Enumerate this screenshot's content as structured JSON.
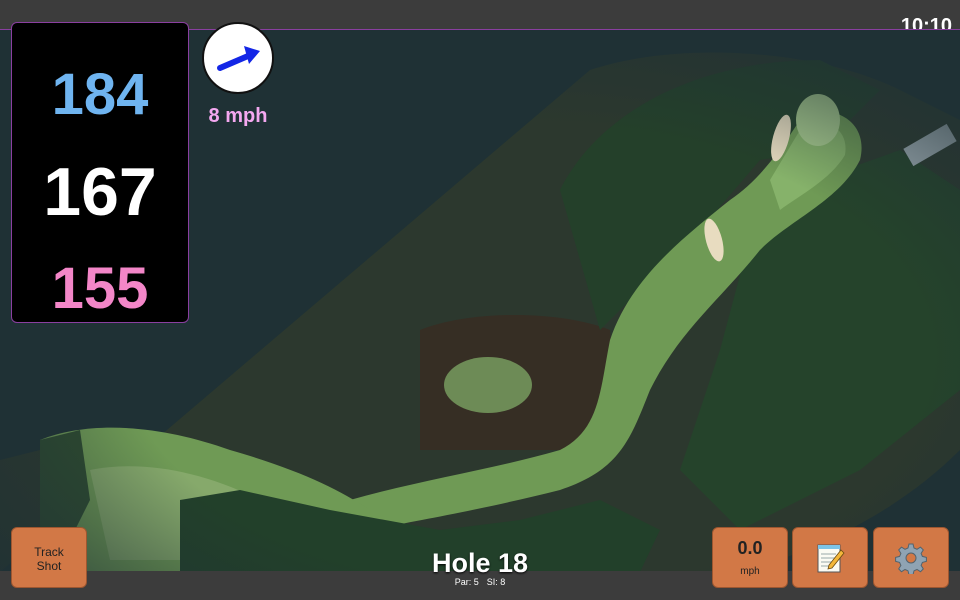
{
  "status": {
    "time": "10:10"
  },
  "distances": {
    "back": "184",
    "middle": "167",
    "front": "155"
  },
  "wind": {
    "speed_label": "8 mph",
    "arrow_color": "#1326e6"
  },
  "hole": {
    "title": "Hole 18",
    "par_label": "Par: 5",
    "si_label": "SI: 8"
  },
  "buttons": {
    "track_shot_line1": "Track",
    "track_shot_line2": "Shot",
    "speed_value": "0.0",
    "speed_unit": "mph",
    "notes_icon": "notepad-icon",
    "settings_icon": "gear-icon"
  },
  "colors": {
    "back_distance": "#6fb4f0",
    "middle_distance": "#ffffff",
    "front_distance": "#f386c8",
    "button": "#d27846",
    "accent_border": "#8a3fa0"
  }
}
